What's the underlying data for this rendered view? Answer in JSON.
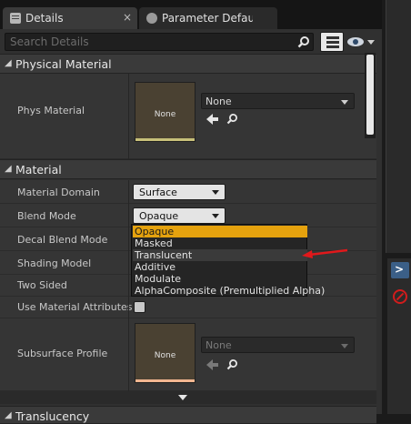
{
  "tabs": [
    {
      "label": "Details",
      "active": true,
      "close": "×"
    },
    {
      "label": "Parameter Defaults",
      "active": false,
      "close": "×"
    }
  ],
  "search": {
    "placeholder": "Search Details"
  },
  "sections": {
    "physical_material": {
      "title": "Physical Material",
      "rows": [
        {
          "label": "Phys Material",
          "thumbnail": "None",
          "value": "None"
        }
      ]
    },
    "material": {
      "title": "Material",
      "rows": [
        {
          "label": "Material Domain",
          "value": "Surface"
        },
        {
          "label": "Blend Mode",
          "value": "Opaque"
        },
        {
          "label": "Decal Blend Mode"
        },
        {
          "label": "Shading Model"
        },
        {
          "label": "Two Sided"
        },
        {
          "label": "Use Material Attributes",
          "checked": false
        },
        {
          "label": "Subsurface Profile",
          "thumbnail": "None",
          "value": "None"
        }
      ]
    },
    "next_section": {
      "title": "Translucency"
    }
  },
  "blend_mode_options": [
    {
      "label": "Opaque",
      "selected": true
    },
    {
      "label": "Masked"
    },
    {
      "label": "Translucent",
      "hovered": true
    },
    {
      "label": "Additive"
    },
    {
      "label": "Modulate"
    },
    {
      "label": "AlphaComposite (Premultiplied Alpha)"
    }
  ],
  "colors": {
    "accent": "#e5a20e",
    "annotation_arrow": "#e0181b",
    "panel": "#303030",
    "error": "#d21c1c"
  },
  "icons": [
    "tab-details-icon",
    "tab-parameter-icon",
    "search-icon",
    "grid-view-icon",
    "eye-icon",
    "use-selected-arrow-icon",
    "browse-icon",
    "expand-arrow-icon",
    "error-icon",
    "console-icon"
  ]
}
